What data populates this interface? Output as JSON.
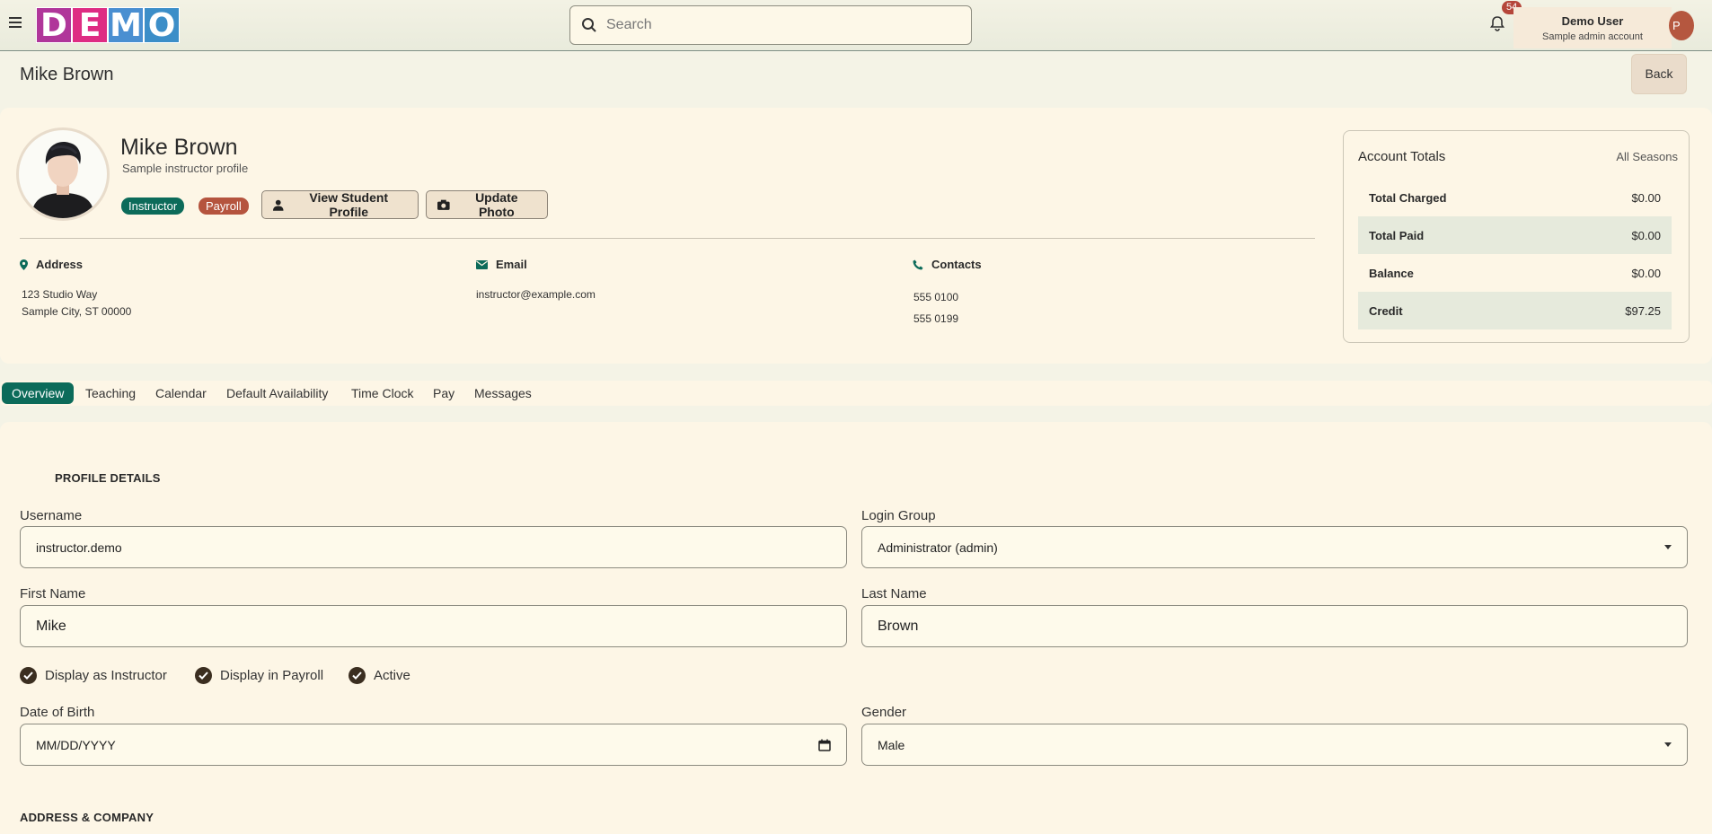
{
  "app": {
    "logo_letters": [
      {
        "char": "D",
        "color": "#b0369a"
      },
      {
        "char": "E",
        "color": "#de2c83"
      },
      {
        "char": "M",
        "color": "#4a8fd1"
      },
      {
        "char": "O",
        "color": "#3c8ec8"
      }
    ],
    "search_placeholder": "Search",
    "notification_count": "54",
    "user_name": "Demo User",
    "user_subtitle": "Sample admin account",
    "user_initial": "P"
  },
  "page": {
    "title": "Mike Brown",
    "back_label": "Back"
  },
  "profile": {
    "name": "Mike Brown",
    "subtitle": "Sample instructor profile",
    "badges": [
      "Instructor",
      "Payroll"
    ],
    "view_student_label": "View Student Profile",
    "update_photo_label": "Update Photo",
    "address_heading": "Address",
    "address_line1": "123 Studio Way",
    "address_line2": "Sample City, ST 00000",
    "email_heading": "Email",
    "email": "instructor@example.com",
    "contacts_heading": "Contacts",
    "phone1": "555 0100",
    "phone2": "555 0199"
  },
  "totals": {
    "title": "Account Totals",
    "season": "All Seasons",
    "rows": [
      {
        "label": "Total Charged",
        "value": "$0.00"
      },
      {
        "label": "Total Paid",
        "value": "$0.00"
      },
      {
        "label": "Balance",
        "value": "$0.00"
      },
      {
        "label": "Credit",
        "value": "$97.25"
      }
    ]
  },
  "tabs": [
    "Overview",
    "Teaching",
    "Calendar",
    "Default Availability",
    "Time Clock",
    "Pay",
    "Messages"
  ],
  "form": {
    "profile_details_title": "PROFILE DETAILS",
    "username_label": "Username",
    "username_value": "instructor.demo",
    "login_group_label": "Login Group",
    "login_group_value": "Administrator (admin)",
    "first_name_label": "First Name",
    "first_name_value": "Mike",
    "last_name_label": "Last Name",
    "last_name_value": "Brown",
    "checkboxes": [
      "Display as Instructor",
      "Display in Payroll",
      "Active"
    ],
    "dob_label": "Date of Birth",
    "dob_placeholder": "MM/DD/YYYY",
    "gender_label": "Gender",
    "gender_value": "Male",
    "address_company_title": "ADDRESS & COMPANY"
  }
}
